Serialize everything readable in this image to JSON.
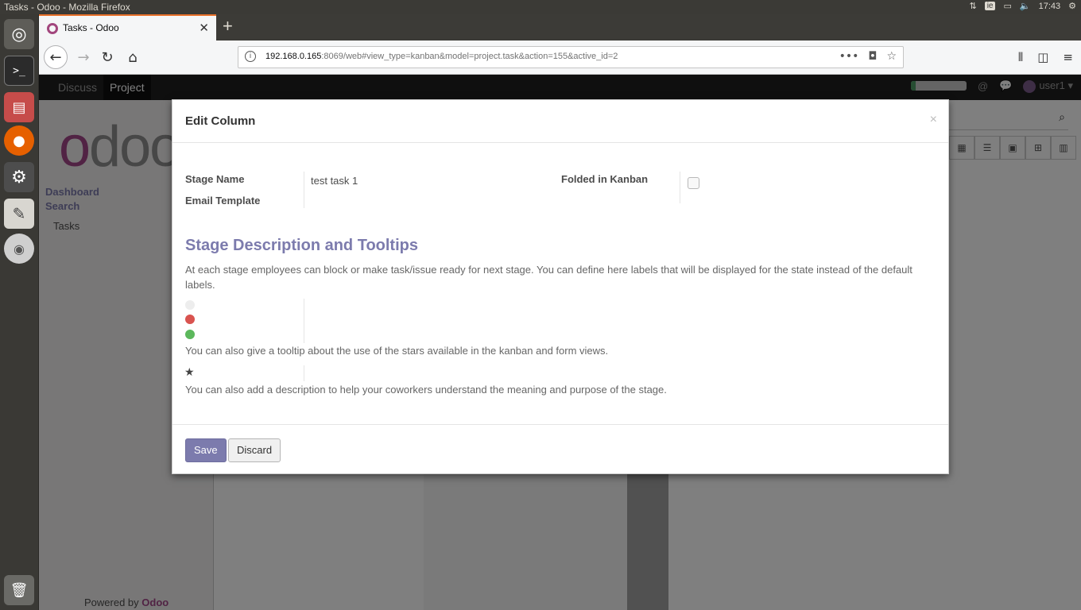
{
  "os": {
    "window_title": "Tasks - Odoo - Mozilla Firefox",
    "keyboard_layout": "ie",
    "clock": "17:43"
  },
  "browser": {
    "tab_title": "Tasks - Odoo",
    "url_host": "192.168.0.165",
    "url_rest": ":8069/web#view_type=kanban&model=project.task&action=155&active_id=2"
  },
  "odoo": {
    "menu": [
      "Discuss",
      "Project"
    ],
    "user": "user1",
    "sidebar": {
      "dashboard": "Dashboard",
      "search": "Search",
      "tasks": "Tasks",
      "powered_by": "Powered by",
      "powered_brand": "Odoo"
    }
  },
  "modal": {
    "title": "Edit Column",
    "close": "×",
    "fields": {
      "stage_name_label": "Stage Name",
      "stage_name_value": "test task 1",
      "email_template_label": "Email Template",
      "folded_label": "Folded in Kanban",
      "folded_checked": false
    },
    "section_title": "Stage Description and Tooltips",
    "desc_1": "At each stage employees can block or make task/issue ready for next stage. You can define here labels that will be displayed for the state instead of the default labels.",
    "desc_2": "You can also give a tooltip about the use of the stars available in the kanban and form views.",
    "desc_3": "You can also add a description to help your coworkers understand the meaning and purpose of the stage.",
    "state_colors": {
      "normal": "#ededed",
      "blocked": "#d9534f",
      "done": "#5cb85c"
    },
    "save_label": "Save",
    "discard_label": "Discard"
  }
}
